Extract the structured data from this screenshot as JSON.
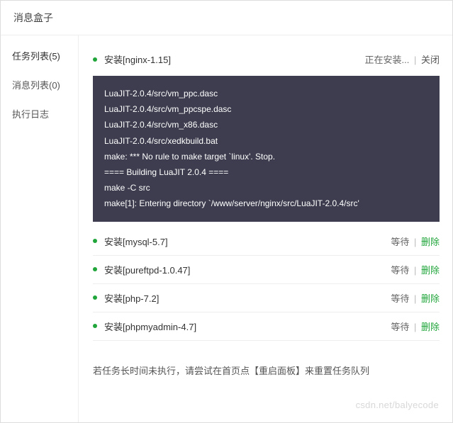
{
  "header": {
    "title": "消息盒子"
  },
  "sidebar": {
    "items": [
      {
        "label": "任务列表(5)",
        "active": true
      },
      {
        "label": "消息列表(0)",
        "active": false
      },
      {
        "label": "执行日志",
        "active": false
      }
    ]
  },
  "tasks": [
    {
      "label": "安装[nginx-1.15]",
      "status_text": "正在安装...",
      "action_label": "关闭",
      "action_type": "close",
      "show_console": true
    },
    {
      "label": "安装[mysql-5.7]",
      "status_text": "等待",
      "action_label": "删除",
      "action_type": "delete",
      "show_console": false
    },
    {
      "label": "安装[pureftpd-1.0.47]",
      "status_text": "等待",
      "action_label": "删除",
      "action_type": "delete",
      "show_console": false
    },
    {
      "label": "安装[php-7.2]",
      "status_text": "等待",
      "action_label": "删除",
      "action_type": "delete",
      "show_console": false
    },
    {
      "label": "安装[phpmyadmin-4.7]",
      "status_text": "等待",
      "action_label": "删除",
      "action_type": "delete",
      "show_console": false
    }
  ],
  "console_lines": [
    "LuaJIT-2.0.4/src/vm_ppc.dasc",
    "LuaJIT-2.0.4/src/vm_ppcspe.dasc",
    "LuaJIT-2.0.4/src/vm_x86.dasc",
    "LuaJIT-2.0.4/src/xedkbuild.bat",
    "make: *** No rule to make target `linux'. Stop.",
    "==== Building LuaJIT 2.0.4 ====",
    "make -C src",
    "make[1]: Entering directory `/www/server/nginx/src/LuaJIT-2.0.4/src'"
  ],
  "footer_note": "若任务长时间未执行，请尝试在首页点【重启面板】来重置任务队列",
  "watermark": "csdn.net/balyecode"
}
